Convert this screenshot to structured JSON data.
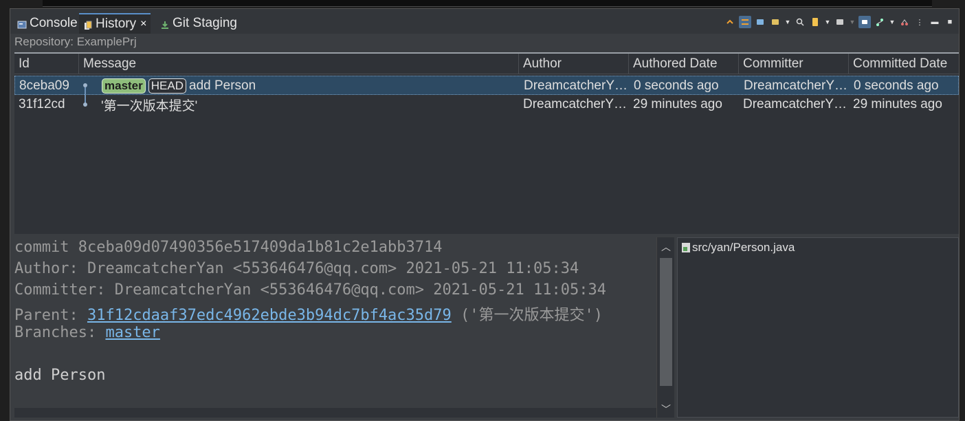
{
  "tabs": [
    {
      "label": "Console",
      "icon": "console-icon"
    },
    {
      "label": "History",
      "icon": "history-icon",
      "active": true
    },
    {
      "label": "Git Staging",
      "icon": "git-staging-icon"
    }
  ],
  "tab_close": "×",
  "repository_label": "Repository: ExamplePrj",
  "columns": [
    "Id",
    "Message",
    "Author",
    "Authored Date",
    "Committer",
    "Committed Date"
  ],
  "commits": [
    {
      "id": "8ceba09",
      "refs": [
        "master",
        "HEAD"
      ],
      "message": "add Person",
      "author": "DreamcatcherY…",
      "authored_date": "0 seconds ago",
      "committer": "DreamcatcherY…",
      "committed_date": "0 seconds ago",
      "selected": true
    },
    {
      "id": "31f12cd",
      "refs": [],
      "message": "'第一次版本提交'",
      "author": "DreamcatcherY…",
      "authored_date": "29 minutes ago",
      "committer": "DreamcatcherY…",
      "committed_date": "29 minutes ago",
      "selected": false
    }
  ],
  "details": {
    "commit_line": "commit 8ceba09d07490356e517409da1b81c2e1abb3714",
    "author_line": "Author: DreamcatcherYan <553646476@qq.com> 2021-05-21 11:05:34",
    "committer_line": "Committer: DreamcatcherYan <553646476@qq.com> 2021-05-21 11:05:34",
    "parent_label": "Parent: ",
    "parent_hash": "31f12cdaaf37edc4962ebde3b94dc7bf4ac35d79",
    "parent_message": " ('第一次版本提交')",
    "branches_label": "Branches: ",
    "branch": "master",
    "message": "add Person"
  },
  "changed_files": [
    "src/yan/Person.java"
  ],
  "colors": {
    "selection": "#2d4a63",
    "master_badge": "#8fbe7c",
    "link": "#79b6e8"
  }
}
